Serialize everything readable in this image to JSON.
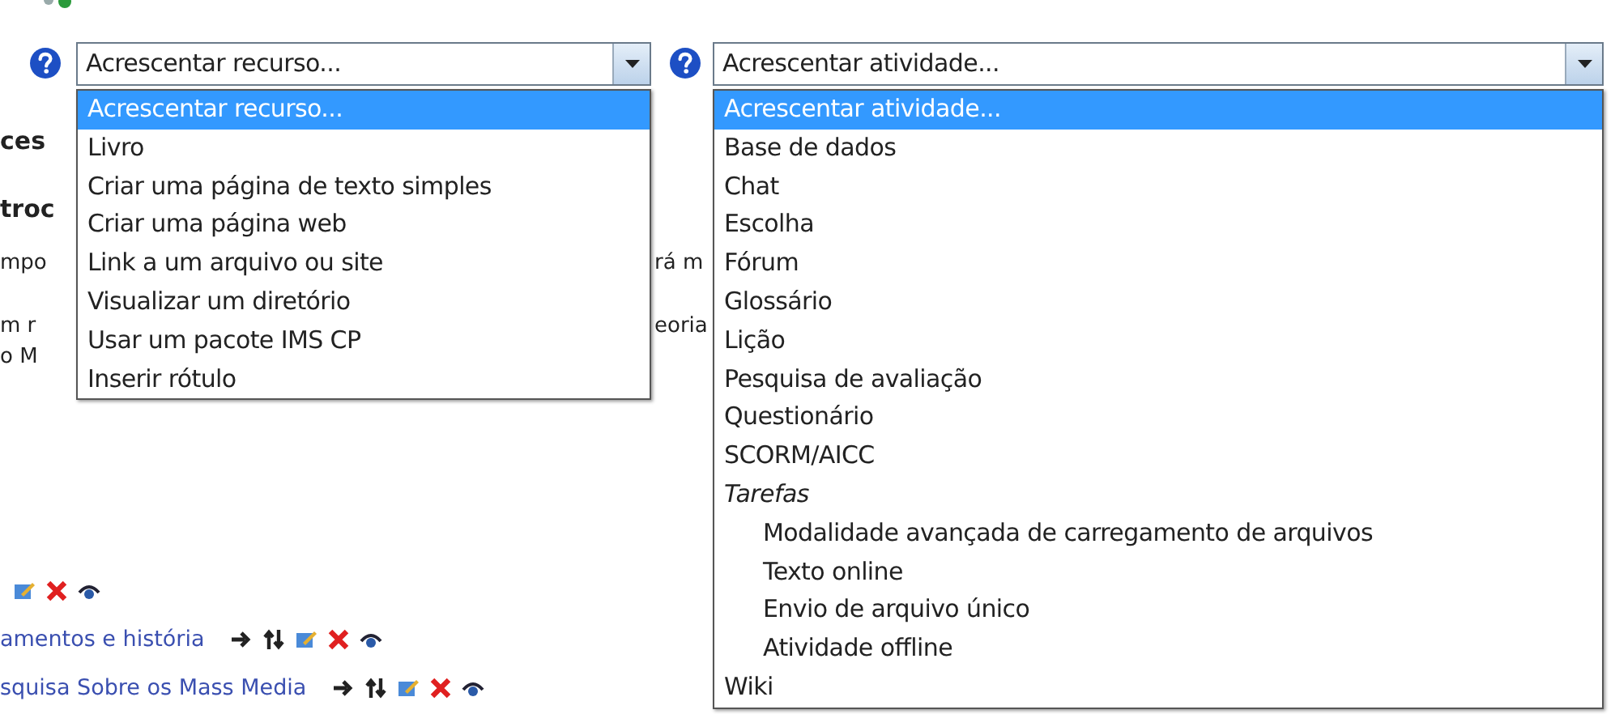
{
  "selects": [
    {
      "value": "Acrescentar recurso...",
      "options": [
        {
          "label": "Acrescentar recurso...",
          "kind": "option",
          "selected": true
        },
        {
          "label": "Livro",
          "kind": "option",
          "selected": false
        },
        {
          "label": "Criar uma página de texto simples",
          "kind": "option",
          "selected": false
        },
        {
          "label": "Criar uma página web",
          "kind": "option",
          "selected": false
        },
        {
          "label": "Link a um arquivo ou site",
          "kind": "option",
          "selected": false
        },
        {
          "label": "Visualizar um diretório",
          "kind": "option",
          "selected": false
        },
        {
          "label": "Usar um pacote IMS CP",
          "kind": "option",
          "selected": false
        },
        {
          "label": "Inserir rótulo",
          "kind": "option",
          "selected": false
        }
      ]
    },
    {
      "value": "Acrescentar atividade...",
      "options": [
        {
          "label": "Acrescentar atividade...",
          "kind": "option",
          "selected": true
        },
        {
          "label": "Base de dados",
          "kind": "option",
          "selected": false
        },
        {
          "label": "Chat",
          "kind": "option",
          "selected": false
        },
        {
          "label": "Escolha",
          "kind": "option",
          "selected": false
        },
        {
          "label": "Fórum",
          "kind": "option",
          "selected": false
        },
        {
          "label": "Glossário",
          "kind": "option",
          "selected": false
        },
        {
          "label": "Lição",
          "kind": "option",
          "selected": false
        },
        {
          "label": "Pesquisa de avaliação",
          "kind": "option",
          "selected": false
        },
        {
          "label": "Questionário",
          "kind": "option",
          "selected": false
        },
        {
          "label": "SCORM/AICC",
          "kind": "option",
          "selected": false
        },
        {
          "label": "Tarefas",
          "kind": "group",
          "selected": false,
          "children": [
            {
              "label": "Modalidade avançada de carregamento de arquivos",
              "selected": false
            },
            {
              "label": "Texto online",
              "selected": false
            },
            {
              "label": "Envio de arquivo único",
              "selected": false
            },
            {
              "label": "Atividade offline",
              "selected": false
            }
          ]
        },
        {
          "label": "Wiki",
          "kind": "option",
          "selected": false
        }
      ]
    }
  ],
  "page_behind": {
    "lines": [
      {
        "left": "ces",
        "kind": "heading"
      },
      {
        "left": "troc",
        "kind": "heading"
      },
      {
        "left": "mpo",
        "right": "rá m",
        "kind": "text"
      },
      {
        "left": "m r",
        "right": "eoria",
        "kind": "text"
      },
      {
        "left": "o M",
        "kind": "text"
      }
    ],
    "activities": [
      {
        "kind": "partial"
      },
      {
        "kind": "full",
        "title": "amentos e história"
      },
      {
        "kind": "full",
        "title": "squisa Sobre os Mass Media"
      }
    ]
  }
}
